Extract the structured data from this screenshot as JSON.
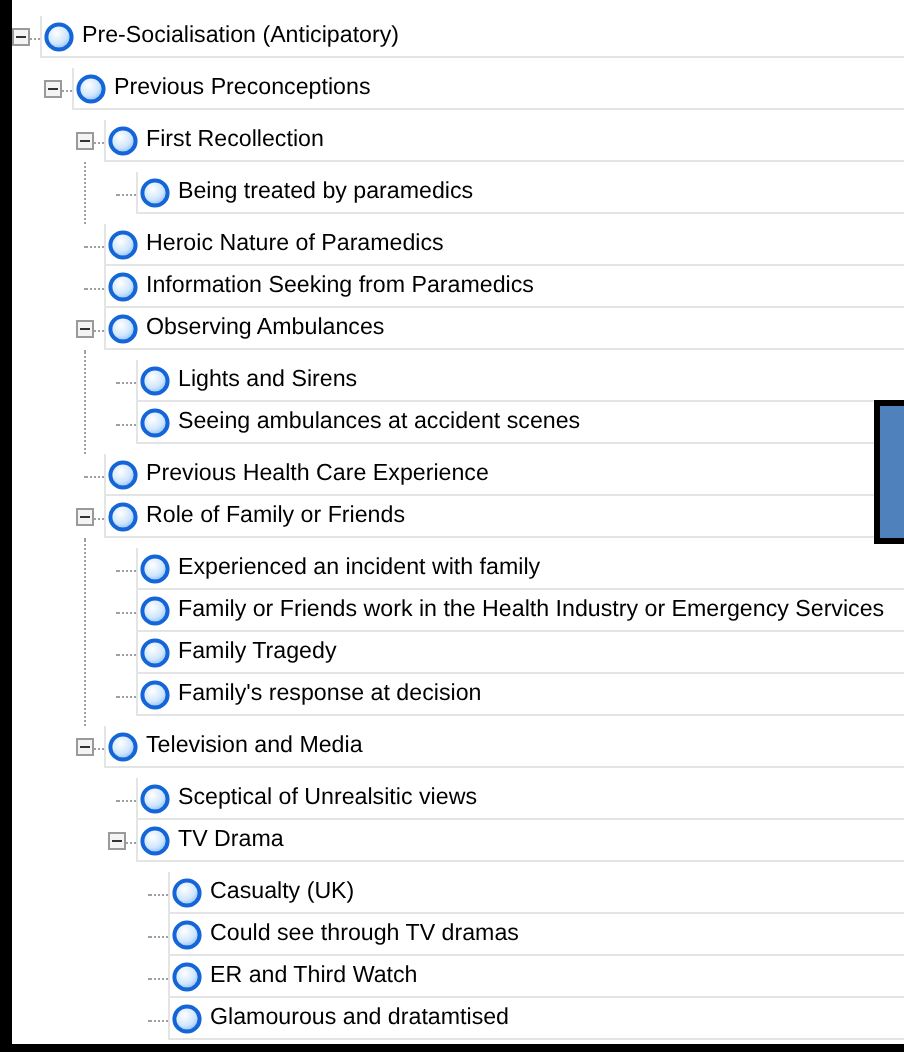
{
  "tree": [
    {
      "label": "Pre-Socialisation (Anticipatory)",
      "expanded": true,
      "children": [
        {
          "label": "Previous Preconceptions",
          "expanded": true,
          "children": [
            {
              "label": "First Recollection",
              "expanded": true,
              "children": [
                {
                  "label": "Being treated by paramedics"
                }
              ]
            },
            {
              "label": "Heroic Nature of Paramedics"
            },
            {
              "label": "Information Seeking from Paramedics"
            },
            {
              "label": "Observing Ambulances",
              "expanded": true,
              "children": [
                {
                  "label": "Lights and Sirens"
                },
                {
                  "label": "Seeing ambulances at accident scenes"
                }
              ]
            },
            {
              "label": "Previous Health Care Experience"
            },
            {
              "label": "Role of Family or Friends",
              "expanded": true,
              "children": [
                {
                  "label": "Experienced an incident with family"
                },
                {
                  "label": "Family or Friends work in the Health Industry or Emergency Services"
                },
                {
                  "label": "Family Tragedy"
                },
                {
                  "label": "Family's response at decision"
                }
              ]
            },
            {
              "label": "Television and Media",
              "expanded": true,
              "children": [
                {
                  "label": "Sceptical of Unrealsitic views"
                },
                {
                  "label": "TV Drama",
                  "expanded": true,
                  "children": [
                    {
                      "label": "Casualty (UK)"
                    },
                    {
                      "label": "Could see through TV dramas"
                    },
                    {
                      "label": "ER and Third Watch"
                    },
                    {
                      "label": "Glamourous and dratamtised"
                    }
                  ]
                }
              ]
            }
          ]
        }
      ]
    }
  ]
}
